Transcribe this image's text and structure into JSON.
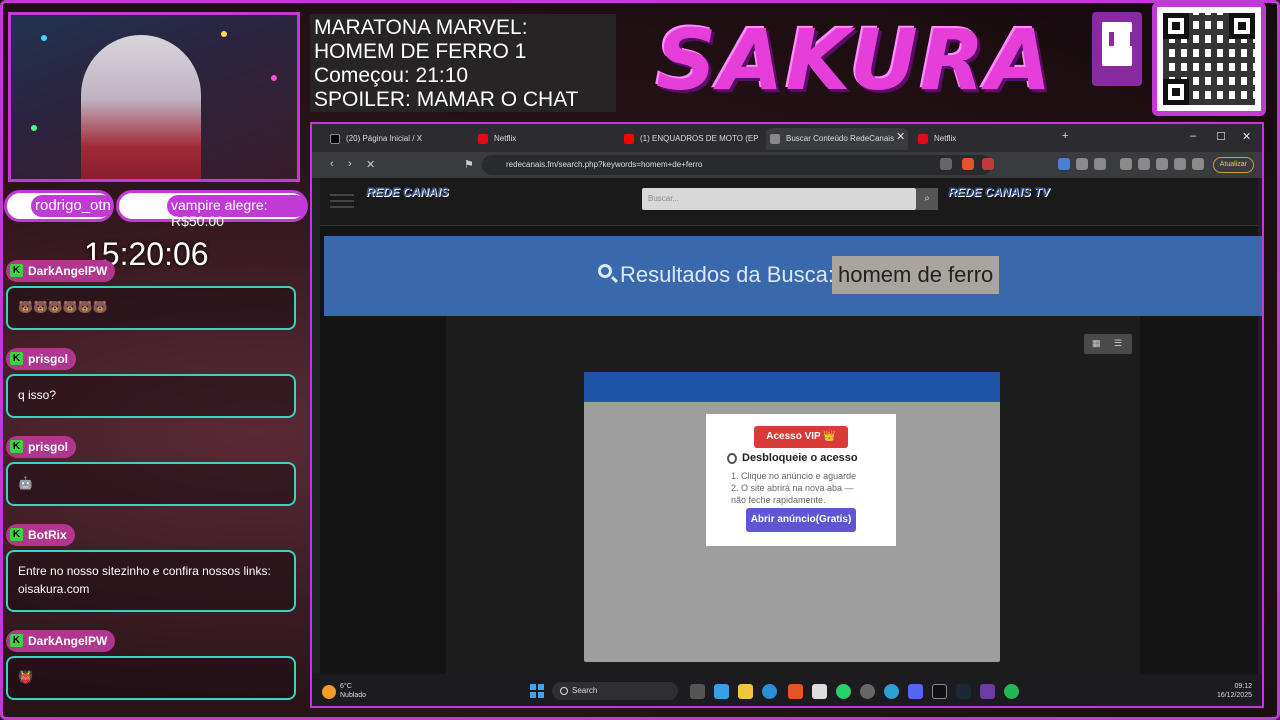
{
  "overlay": {
    "marathon_lines": [
      "MARATONA MARVEL:",
      "HOMEM DE FERRO 1",
      "Começou: 21:10",
      "SPOILER: MAMAR O CHAT"
    ],
    "logo_text": "SAKURA",
    "clock": "15:20:06",
    "alerts": [
      {
        "user": "rodrigo_otn"
      },
      {
        "text": "vampire alegre: R$50.00"
      }
    ]
  },
  "chat": {
    "messages": [
      {
        "user": "DarkAngelPW",
        "text": "🐻🐻🐻🐻🐻🐻"
      },
      {
        "user": "prisgol",
        "text": "q isso?"
      },
      {
        "user": "prisgol",
        "text": "🤖"
      },
      {
        "user": "BotRix",
        "text": "Entre no nosso sitezinho e confira nossos links: oisakura.com"
      },
      {
        "user": "DarkAngelPW",
        "text": "👹"
      }
    ]
  },
  "browser": {
    "tabs": [
      {
        "label": "(20) Página Inicial / X",
        "icon": "x-icon",
        "color": "#000000"
      },
      {
        "label": "Netflix",
        "icon": "netflix-icon",
        "color": "#e50914"
      },
      {
        "label": "(1) ENQUADROS DE MOTO (EP. 127)",
        "icon": "youtube-icon",
        "color": "#ff0000"
      },
      {
        "label": "Buscar Conteúdo RedeCanais",
        "icon": "rede-icon",
        "color": "#888888",
        "active": true
      },
      {
        "label": "Netflix",
        "icon": "netflix-icon",
        "color": "#e50914"
      }
    ],
    "url": "redecanais.fm/search.php?keywords=homem+de+ferro",
    "update_label": "Atualizar"
  },
  "site": {
    "logo": "REDE CANAIS",
    "logo2": "REDE CANAIS TV",
    "search_placeholder": "Buscar...",
    "results_label": "Resultados da Busca:",
    "query": "homem de ferro"
  },
  "modal": {
    "vip_label": "Acesso VIP 👑",
    "title": "Desbloqueie o acesso",
    "steps": [
      "1. Clique no anúncio e aguarde",
      "2. O site abrirá na nova aba —",
      "não feche rapidamente."
    ],
    "open_label": "Abrir anúncio(Gratis)"
  },
  "taskbar": {
    "temp": "6°C",
    "weather": "Nublado",
    "search_label": "Search",
    "time": "09:12",
    "date": "16/12/2025"
  },
  "colors": {
    "accent": "#c13ad6",
    "banner": "#3a68ad",
    "vip": "#d93a3a",
    "open": "#6155d6"
  }
}
